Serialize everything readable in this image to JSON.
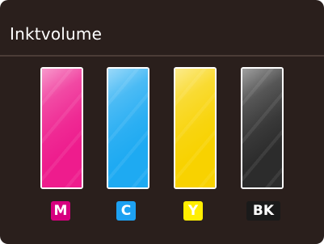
{
  "screen": {
    "title": "Inktvolume",
    "background": "#2a1f1c"
  },
  "cartridges": [
    {
      "id": "magenta",
      "label": "M",
      "color": "#ee1c8d",
      "level_percent": 100,
      "label_bg": "#d6007f",
      "label_text_color": "#ffffff"
    },
    {
      "id": "cyan",
      "label": "C",
      "color": "#1eaaf2",
      "level_percent": 100,
      "label_bg": "#1da1f2",
      "label_text_color": "#ffffff"
    },
    {
      "id": "yellow",
      "label": "Y",
      "color": "#f8d200",
      "level_percent": 100,
      "label_bg": "#ffee00",
      "label_text_color": "#ffffff"
    },
    {
      "id": "black",
      "label": "BK",
      "color": "#2c2c2c",
      "level_percent": 100,
      "label_bg": "#1a1a1a",
      "label_text_color": "#ffffff"
    }
  ]
}
